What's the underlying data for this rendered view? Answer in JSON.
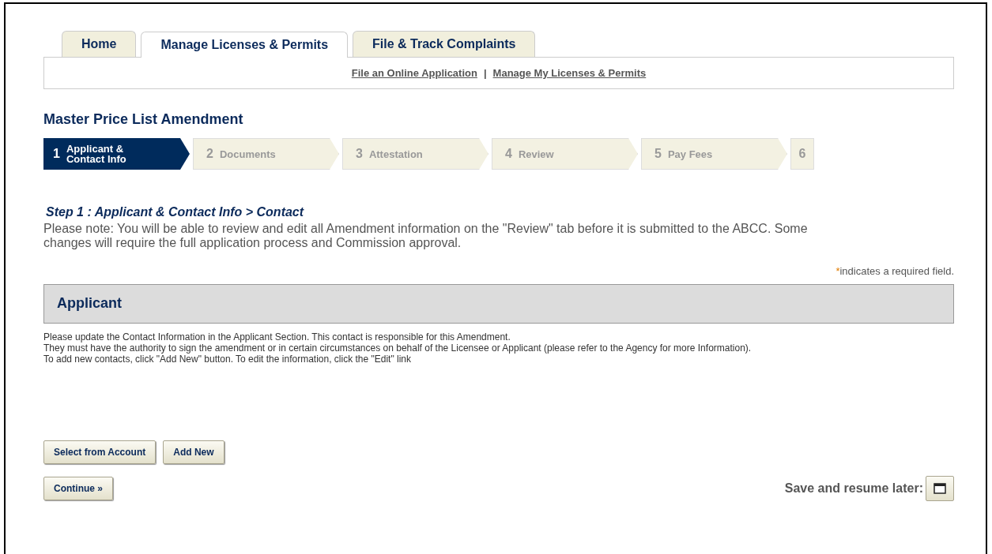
{
  "tabs": [
    {
      "label": "Home",
      "selected": false
    },
    {
      "label": "Manage Licenses & Permits",
      "selected": true
    },
    {
      "label": "File & Track Complaints",
      "selected": false
    }
  ],
  "sub_links": [
    "File an Online Application",
    "Manage My Licenses & Permits"
  ],
  "sub_separator": "|",
  "page_title": "Master Price List Amendment",
  "steps": [
    {
      "number": "1",
      "label": "Applicant & Contact Info",
      "selected": true
    },
    {
      "number": "2",
      "label": "Documents",
      "selected": false
    },
    {
      "number": "3",
      "label": "Attestation",
      "selected": false
    },
    {
      "number": "4",
      "label": "Review",
      "selected": false
    },
    {
      "number": "5",
      "label": "Pay Fees",
      "selected": false
    },
    {
      "number": "6",
      "selected": false
    }
  ],
  "step_heading": "Step 1 : Applicant & Contact Info > Contact",
  "note": "Please note: You will be able to review and edit all Amendment information on the \"Review\" tab before it is submitted to the ABCC. Some changes will require the full application process and Commission approval.",
  "required_mark": "*",
  "required_text": "indicates a required field.",
  "section_title": "Applicant",
  "instructions": [
    "Please update the Contact Information in the Applicant Section. This contact is responsible for this Amendment.",
    "They must have the authority to sign the amendment or in certain circumstances on behalf of the Licensee or Applicant (please refer to the Agency for more Information).",
    "To add new contacts, click \"Add New\" button. To edit the information, click the \"Edit\" link"
  ],
  "contact_buttons": [
    "Select from Account",
    "Add New"
  ],
  "continue_button": "Continue »",
  "save_label": "Save and resume later:"
}
